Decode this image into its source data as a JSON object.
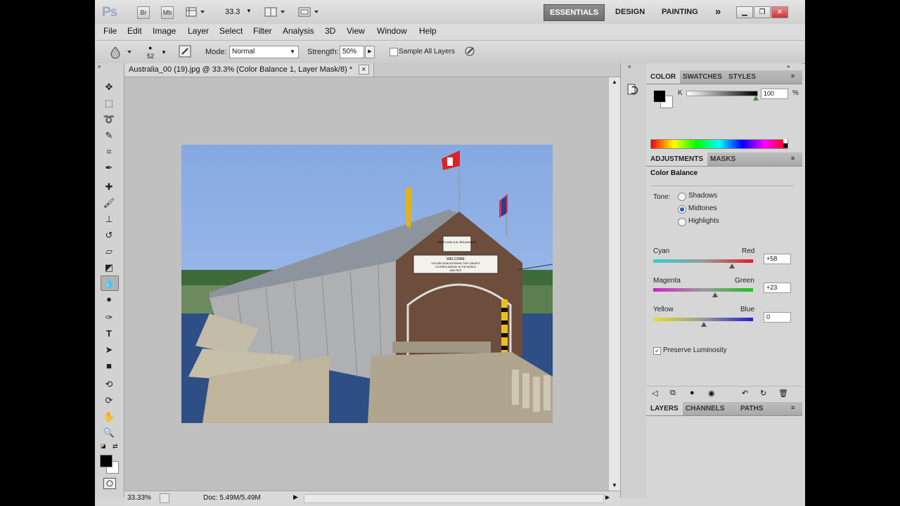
{
  "titlebar": {
    "logo": "Ps",
    "br_label": "Br",
    "mb_label": "Mb",
    "zoom_value": "33.3",
    "workspaces": [
      "ESSENTIALS",
      "DESIGN",
      "PAINTING"
    ],
    "more_label": "»"
  },
  "menu": [
    "File",
    "Edit",
    "Image",
    "Layer",
    "Select",
    "Filter",
    "Analysis",
    "3D",
    "View",
    "Window",
    "Help"
  ],
  "options": {
    "brush_size": "52",
    "mode_label": "Mode:",
    "mode_value": "Normal",
    "strength_label": "Strength:",
    "strength_value": "50%",
    "sample_all_label": "Sample All Layers"
  },
  "document": {
    "tab_title": "Australia_00 (19).jpg @ 33.3% (Color Balance 1, Layer Mask/8) *",
    "tab_close": "×",
    "image_signs": [
      "HARTLAND N.B. BRUNSWICK",
      "WELCOME",
      "YOU ARE NOW ENTERING THE LONGEST",
      "COVERED BRIDGE IN THE WORLD",
      "1282 FEET"
    ]
  },
  "status": {
    "zoom": "33.33%",
    "doc_info": "Doc: 5.49M/5.49M"
  },
  "color_panel": {
    "tabs": [
      "COLOR",
      "SWATCHES",
      "STYLES"
    ],
    "k_label": "K",
    "k_value": "100",
    "k_unit": "%"
  },
  "adjustments": {
    "tabs": [
      "ADJUSTMENTS",
      "MASKS"
    ],
    "title": "Color Balance",
    "tone_label": "Tone:",
    "tones": [
      {
        "label": "Shadows",
        "selected": false
      },
      {
        "label": "Midtones",
        "selected": true
      },
      {
        "label": "Highlights",
        "selected": false
      }
    ],
    "sliders": [
      {
        "left": "Cyan",
        "right": "Red",
        "value": "+58",
        "level": 58
      },
      {
        "left": "Magenta",
        "right": "Green",
        "value": "+23",
        "level": 23
      },
      {
        "left": "Yellow",
        "right": "Blue",
        "value": "0",
        "level": 0
      }
    ],
    "preserve_label": "Preserve Luminosity",
    "preserve_checked": true
  },
  "layers_panel": {
    "tabs": [
      "LAYERS",
      "CHANNELS",
      "PATHS"
    ]
  },
  "colors": {
    "accent": "#1d5fbf",
    "sky": "#8fb2e6",
    "water": "#2d4f86",
    "foreground": "#000000",
    "background": "#ffffff"
  }
}
